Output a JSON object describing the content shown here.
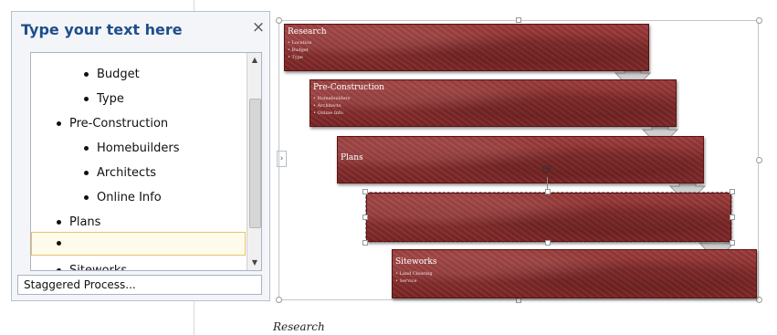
{
  "text_pane": {
    "title": "Type your text here",
    "close_glyph": "×",
    "items": [
      {
        "text": "Budget",
        "level": 2
      },
      {
        "text": "Type",
        "level": 2
      },
      {
        "text": "Pre-Construction",
        "level": 1
      },
      {
        "text": "Homebuilders",
        "level": 2
      },
      {
        "text": "Architects",
        "level": 2
      },
      {
        "text": "Online Info",
        "level": 2
      },
      {
        "text": "Plans",
        "level": 1
      },
      {
        "text": "",
        "level": 1
      },
      {
        "text": "Siteworks",
        "level": 1
      }
    ],
    "footer_label": "Staggered Process..."
  },
  "expander_glyph": "›",
  "rotate_glyph": "⟳",
  "diagram": {
    "shapes": [
      {
        "title": "Research",
        "bullets": [
          "Location",
          "Budget",
          "Type"
        ]
      },
      {
        "title": "Pre-Construction",
        "bullets": [
          "Homebuilders",
          "Architects",
          "Online Info"
        ]
      },
      {
        "title": "Plans",
        "bullets": []
      },
      {
        "title": "",
        "bullets": []
      },
      {
        "title": "Siteworks",
        "bullets": [
          "Land Clearing",
          "Service"
        ]
      }
    ],
    "shape_color": "#8a2f2f",
    "arrow_color": "#c9c9c9"
  },
  "document": {
    "caption": "Research"
  }
}
